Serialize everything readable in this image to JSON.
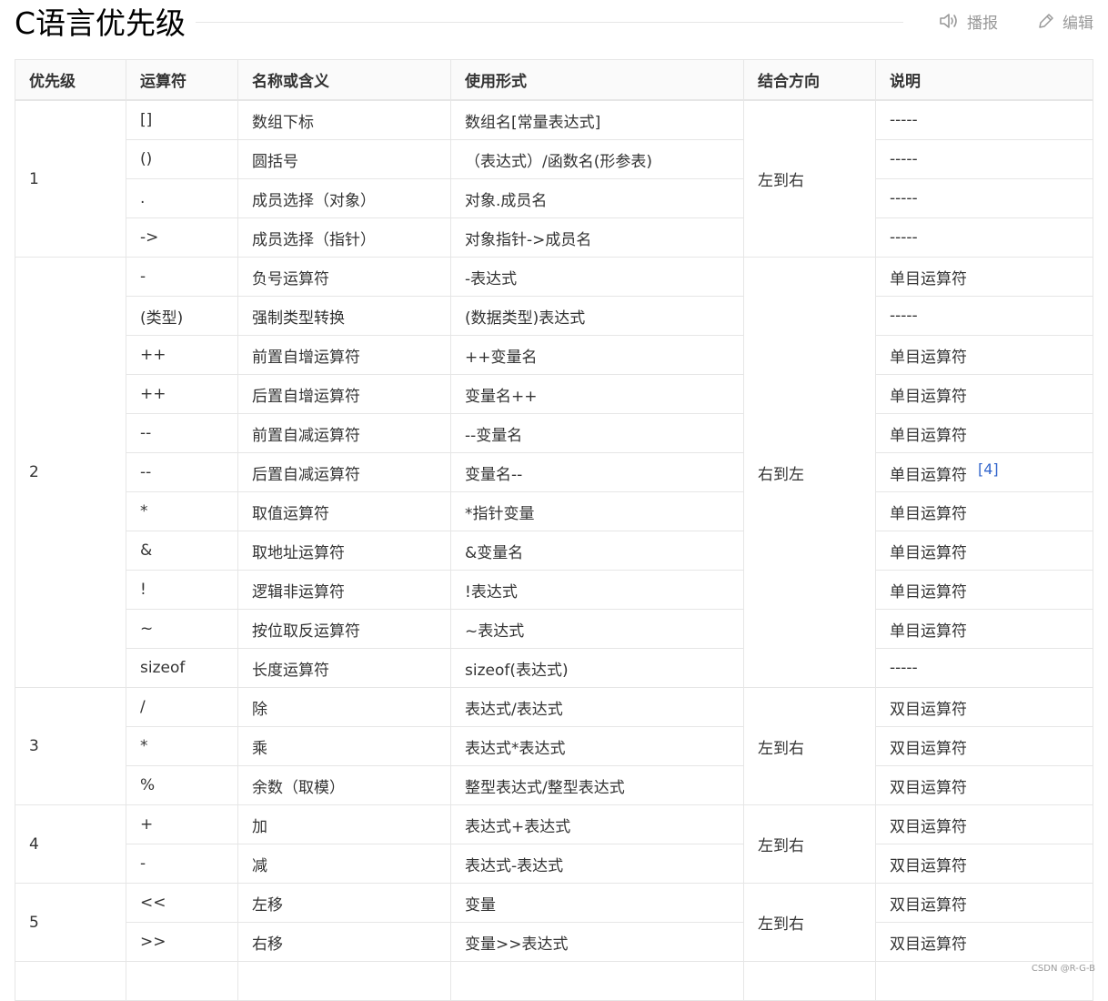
{
  "page": {
    "title": "C语言优先级"
  },
  "actions": {
    "play": "播报",
    "edit": "编辑"
  },
  "table": {
    "headers": [
      "优先级",
      "运算符",
      "名称或含义",
      "使用形式",
      "结合方向",
      "说明"
    ],
    "groups": [
      {
        "level": "1",
        "assoc": "左到右",
        "rows": [
          {
            "op": "[]",
            "name": "数组下标",
            "form": "数组名[常量表达式]",
            "note": "-----"
          },
          {
            "op": "()",
            "name": "圆括号",
            "form": "（表达式）/函数名(形参表)",
            "note": "-----"
          },
          {
            "op": ".",
            "name": "成员选择（对象）",
            "form": "对象.成员名",
            "note": "-----"
          },
          {
            "op": "->",
            "name": "成员选择（指针）",
            "form": "对象指针->成员名",
            "note": "-----"
          }
        ]
      },
      {
        "level": "2",
        "assoc": "右到左",
        "rows": [
          {
            "op": "-",
            "name": "负号运算符",
            "form": "-表达式",
            "note": "单目运算符"
          },
          {
            "op": "(类型)",
            "name": "强制类型转换",
            "form": "(数据类型)表达式",
            "note": "-----"
          },
          {
            "op": "++",
            "name": "前置自增运算符",
            "form": "++变量名",
            "note": "单目运算符"
          },
          {
            "op": "++",
            "name": "后置自增运算符",
            "form": "变量名++",
            "note": "单目运算符"
          },
          {
            "op": "--",
            "name": "前置自减运算符",
            "form": "--变量名",
            "note": "单目运算符"
          },
          {
            "op": "--",
            "name": "后置自减运算符",
            "form": "变量名--",
            "note": "单目运算符",
            "footnote": "[4]"
          },
          {
            "op": "*",
            "name": "取值运算符",
            "form": "*指针变量",
            "note": "单目运算符"
          },
          {
            "op": "&",
            "name": "取地址运算符",
            "form": "&变量名",
            "note": "单目运算符"
          },
          {
            "op": "!",
            "name": "逻辑非运算符",
            "form": "!表达式",
            "note": "单目运算符"
          },
          {
            "op": "~",
            "name": "按位取反运算符",
            "form": "~表达式",
            "note": "单目运算符"
          },
          {
            "op": "sizeof",
            "name": "长度运算符",
            "form": "sizeof(表达式)",
            "note": "-----"
          }
        ]
      },
      {
        "level": "3",
        "assoc": "左到右",
        "rows": [
          {
            "op": "/",
            "name": "除",
            "form": "表达式/表达式",
            "note": "双目运算符"
          },
          {
            "op": "*",
            "name": "乘",
            "form": "表达式*表达式",
            "note": "双目运算符"
          },
          {
            "op": "%",
            "name": "余数（取模）",
            "form": "整型表达式/整型表达式",
            "note": "双目运算符"
          }
        ]
      },
      {
        "level": "4",
        "assoc": "左到右",
        "rows": [
          {
            "op": "+",
            "name": "加",
            "form": "表达式+表达式",
            "note": "双目运算符"
          },
          {
            "op": "-",
            "name": "减",
            "form": "表达式-表达式",
            "note": "双目运算符"
          }
        ]
      },
      {
        "level": "5",
        "assoc": "左到右",
        "rows": [
          {
            "op": "<<",
            "name": "左移",
            "form": "变量",
            "note": "双目运算符"
          },
          {
            "op": ">>",
            "name": "右移",
            "form": "变量>>表达式",
            "note": "双目运算符"
          }
        ]
      }
    ]
  },
  "watermark": "CSDN @R-G-B",
  "colors": {
    "border": "#e6e6e6",
    "link": "#3366cc",
    "muted": "#999999"
  },
  "icons": {
    "play": "speaker-icon",
    "edit": "pencil-icon"
  }
}
